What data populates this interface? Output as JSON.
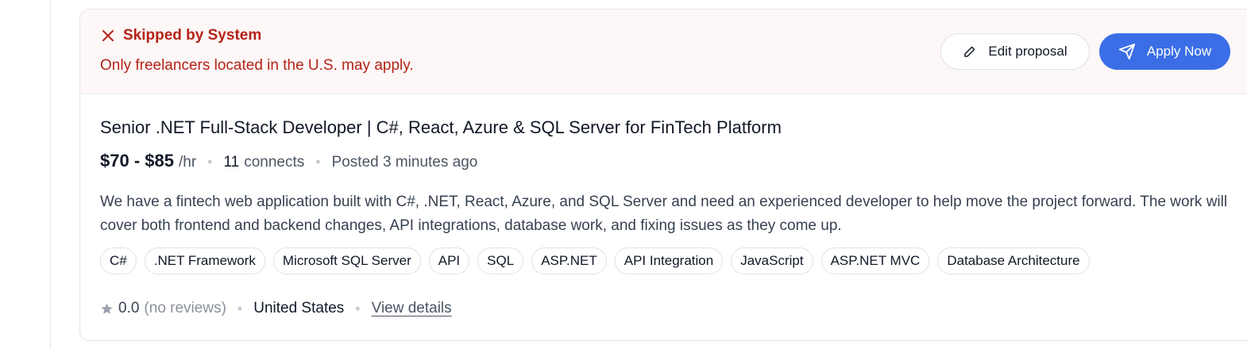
{
  "banner": {
    "status": "Skipped by System",
    "reason": "Only freelancers located in the U.S. may apply.",
    "edit_label": "Edit proposal",
    "apply_label": "Apply Now"
  },
  "job": {
    "title": "Senior .NET Full-Stack Developer | C#, React, Azure & SQL Server for FinTech Platform",
    "rate": "$70 - $85",
    "rate_unit": "/hr",
    "connects_count": "11",
    "connects_label": "connects",
    "posted": "Posted 3 minutes ago",
    "description": "We have a fintech web application built with C#, .NET, React, Azure, and SQL Server and need an experienced developer to help move the project forward. The work will cover both frontend and backend changes, API integrations, database work, and fixing issues as they come up.",
    "skills": [
      "C#",
      ".NET Framework",
      "Microsoft SQL Server",
      "API",
      "SQL",
      "ASP.NET",
      "API Integration",
      "JavaScript",
      "ASP.NET MVC",
      "Database Architecture"
    ]
  },
  "client": {
    "rating": "0.0",
    "reviews": "(no reviews)",
    "location": "United States",
    "view_details": "View details"
  },
  "colors": {
    "danger": "#b42318",
    "primary": "#3b6ee6",
    "banner_bg": "#fdf7f7"
  },
  "icons": {
    "status": "close-icon",
    "edit": "pencil-icon",
    "apply": "send-icon",
    "rating": "star-icon"
  }
}
